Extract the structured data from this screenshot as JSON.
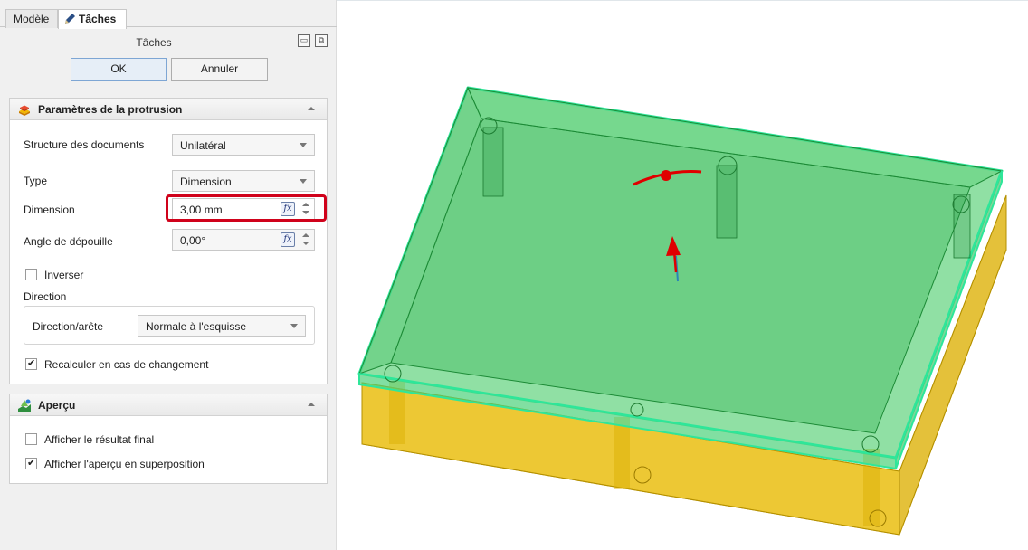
{
  "tabs": {
    "model": "Modèle",
    "tasks": "Tâches"
  },
  "task_panel": {
    "title": "Tâches",
    "ok": "OK",
    "cancel": "Annuler"
  },
  "protrusion": {
    "title": "Paramètres de la protrusion",
    "structure_label": "Structure des documents",
    "structure_value": "Unilatéral",
    "type_label": "Type",
    "type_value": "Dimension",
    "dimension_label": "Dimension",
    "dimension_value": "3,00 mm",
    "draft_label": "Angle de dépouille",
    "draft_value": "0,00°",
    "reverse_label": "Inverser",
    "reverse_checked": false,
    "direction_group": "Direction",
    "direction_edge_label": "Direction/arête",
    "direction_edge_value": "Normale à l'esquisse",
    "recalc_label": "Recalculer en cas de changement",
    "recalc_checked": true
  },
  "preview": {
    "title": "Aperçu",
    "final_label": "Afficher le résultat final",
    "final_checked": false,
    "overlay_label": "Afficher l'aperçu en superposition",
    "overlay_checked": true
  },
  "fx_label": "fx",
  "colors": {
    "highlight": "#d0021b",
    "protrusion_preview": "#34c759",
    "base_body": "#e6b800",
    "edge_outline": "#2ee69a",
    "direction_arrow": "#e00000"
  },
  "icons": {
    "tasks_tab": "pencil-icon",
    "protrusion_section": "pad-icon",
    "preview_section": "preview-icon"
  }
}
